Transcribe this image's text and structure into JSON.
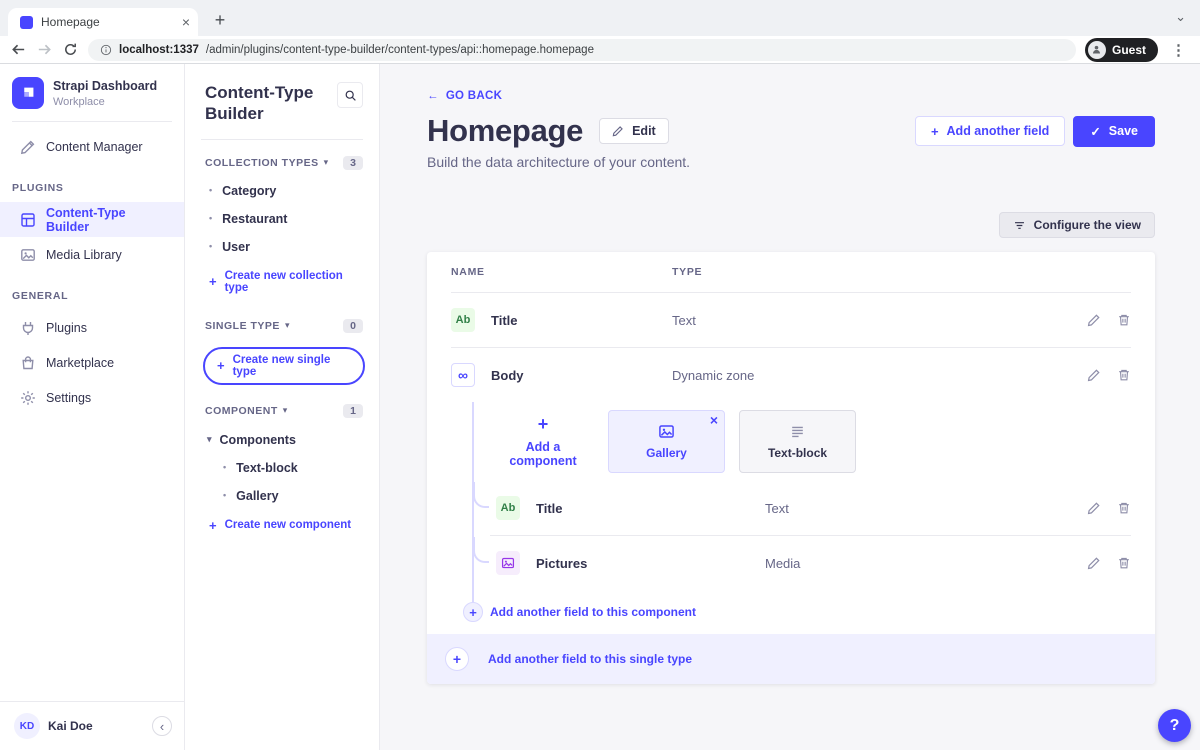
{
  "colors": {
    "primary": "#4945ff",
    "primary_light": "#f0f0ff",
    "text": "#32324d",
    "text_muted": "#666687",
    "border": "#eaeaef",
    "main_bg": "#f6f6f9",
    "text_field_badge_bg": "#eafbe7",
    "text_field_badge_fg": "#328048",
    "media_badge_bg": "#f6edfc",
    "media_badge_fg": "#9736e8"
  },
  "icons": {
    "plus": "+",
    "close": "×",
    "check": "✓",
    "back_arrow": "←",
    "caret_down": "▾",
    "chevron_left": "‹",
    "chevron_down": "⌄",
    "bullet": "•",
    "dots_vertical": "⋮",
    "text_field": "Ab",
    "dynamic_zone": "∞",
    "question": "?"
  },
  "browser": {
    "tab_title": "Homepage",
    "url_host": "localhost:1337",
    "url_path": "/admin/plugins/content-type-builder/content-types/api::homepage.homepage",
    "profile_label": "Guest"
  },
  "sidebar": {
    "brand_title": "Strapi Dashboard",
    "brand_subtitle": "Workplace",
    "content_manager": "Content Manager",
    "plugins_label": "PLUGINS",
    "ctb": "Content-Type Builder",
    "media_library": "Media Library",
    "general_label": "GENERAL",
    "plugins": "Plugins",
    "marketplace": "Marketplace",
    "settings": "Settings",
    "user_initials": "KD",
    "user_name": "Kai Doe"
  },
  "subnav": {
    "title": "Content-Type Builder",
    "collection": {
      "label": "COLLECTION TYPES",
      "count": "3",
      "items": [
        "Category",
        "Restaurant",
        "User"
      ],
      "create": "Create new collection type"
    },
    "single": {
      "label": "SINGLE TYPE",
      "count": "0",
      "create": "Create new single type"
    },
    "component": {
      "label": "COMPONENT",
      "count": "1",
      "group": "Components",
      "items": [
        "Text-block",
        "Gallery"
      ],
      "create": "Create new component"
    }
  },
  "main": {
    "go_back": "GO BACK",
    "title": "Homepage",
    "edit": "Edit",
    "subtitle": "Build the data architecture of your content.",
    "add_field": "Add another field",
    "save": "Save",
    "configure_view": "Configure the view",
    "table": {
      "col_name": "NAME",
      "col_type": "TYPE",
      "rows": [
        {
          "name": "Title",
          "type": "Text"
        },
        {
          "name": "Body",
          "type": "Dynamic zone"
        }
      ],
      "dz": {
        "add_component": "Add a component",
        "components": [
          {
            "label": "Gallery",
            "selected": true
          },
          {
            "label": "Text-block",
            "selected": false
          }
        ],
        "rows": [
          {
            "name": "Title",
            "type": "Text"
          },
          {
            "name": "Pictures",
            "type": "Media"
          }
        ],
        "add_field": "Add another field to this component"
      },
      "add_field_single": "Add another field to this single type"
    }
  }
}
